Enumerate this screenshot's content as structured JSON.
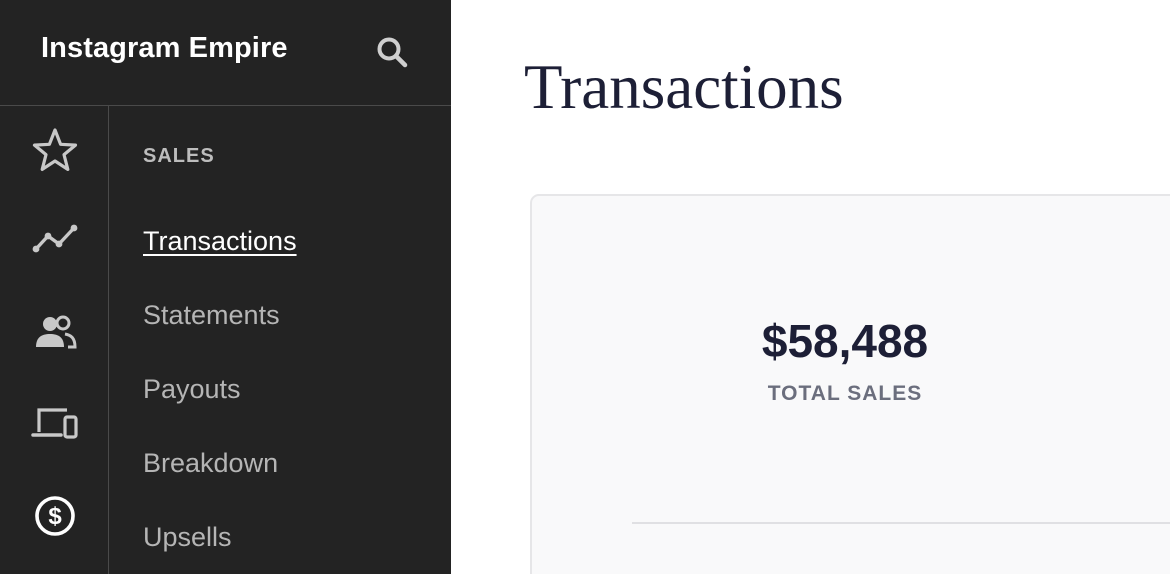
{
  "sidebar": {
    "app_title": "Instagram Empire",
    "search_icon": "search-icon",
    "rail": [
      {
        "icon": "star-icon"
      },
      {
        "icon": "trend-line-icon"
      },
      {
        "icon": "people-icon"
      },
      {
        "icon": "devices-icon"
      },
      {
        "icon": "dollar-circle-icon"
      }
    ],
    "section_label": "SALES",
    "items": [
      {
        "label": "Transactions",
        "active": true
      },
      {
        "label": "Statements",
        "active": false
      },
      {
        "label": "Payouts",
        "active": false
      },
      {
        "label": "Breakdown",
        "active": false
      },
      {
        "label": "Upsells",
        "active": false
      }
    ]
  },
  "main": {
    "title": "Transactions",
    "summary": {
      "value": "$58,488",
      "label": "TOTAL SALES"
    }
  },
  "colors": {
    "sidebar_bg": "#232323",
    "text_dark": "#1d1f36",
    "muted": "#6b6e7d"
  }
}
